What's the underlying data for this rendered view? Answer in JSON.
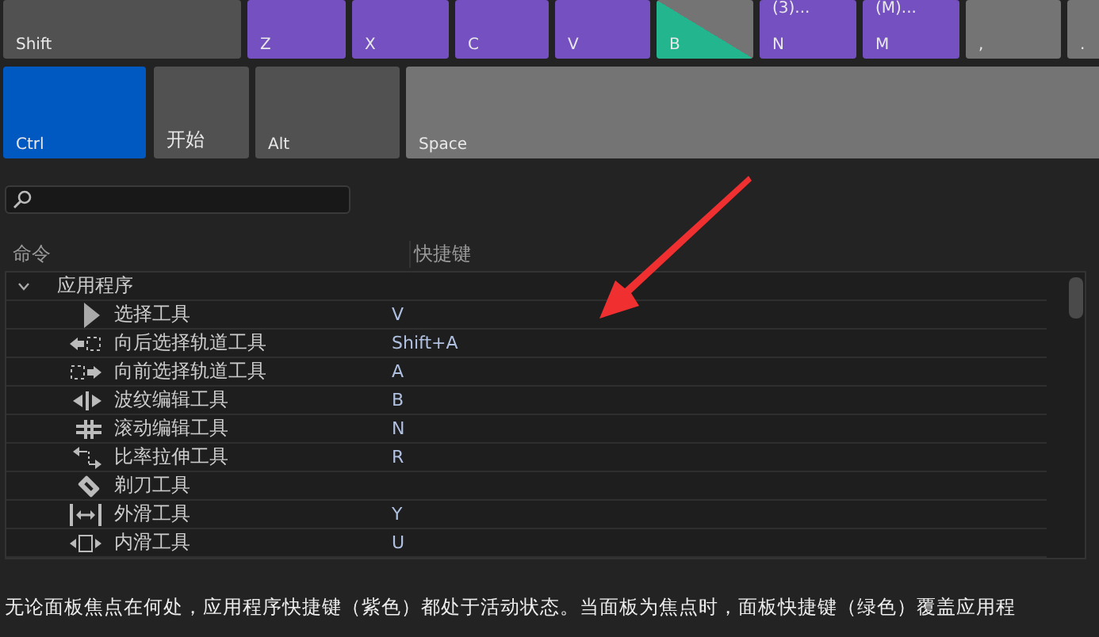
{
  "keyboard": {
    "rows": [
      [
        {
          "label": "Shift",
          "kind": "plain"
        },
        {
          "label": "Z",
          "kind": "app"
        },
        {
          "label": "X",
          "kind": "app"
        },
        {
          "label": "C",
          "kind": "app"
        },
        {
          "label": "V",
          "kind": "app"
        },
        {
          "label": "B",
          "kind": "split"
        },
        {
          "label": "N",
          "top": "(3)...",
          "kind": "app"
        },
        {
          "label": "M",
          "top": "(M)...",
          "kind": "app"
        },
        {
          "label": ",",
          "kind": "light"
        },
        {
          "label": ".",
          "kind": "light"
        }
      ],
      [
        {
          "label": "Ctrl",
          "kind": "modifier"
        },
        {
          "label": "开始",
          "kind": "plain"
        },
        {
          "label": "Alt",
          "kind": "plain"
        },
        {
          "label": "Space",
          "kind": "light"
        }
      ]
    ]
  },
  "table": {
    "columns": [
      "命令",
      "快捷键"
    ],
    "groups": [
      {
        "label": "应用程序",
        "expanded": true,
        "children": [
          {
            "command": "选择工具",
            "shortcut": "V"
          },
          {
            "command": "向后选择轨道工具",
            "shortcut": "Shift+A"
          },
          {
            "command": "向前选择轨道工具",
            "shortcut": "A"
          },
          {
            "command": "波纹编辑工具",
            "shortcut": "B"
          },
          {
            "command": "滚动编辑工具",
            "shortcut": "N"
          },
          {
            "command": "比率拉伸工具",
            "shortcut": "R"
          },
          {
            "command": "剃刀工具"
          },
          {
            "command": "外滑工具",
            "shortcut": "Y"
          },
          {
            "command": "内滑工具",
            "shortcut": "U"
          }
        ]
      }
    ]
  },
  "footer_note": "无论面板焦点在何处，应用程序快捷键（紫色）都处于活动状态。当面板为焦点时，面板快捷键（绿色）覆盖应用程"
}
